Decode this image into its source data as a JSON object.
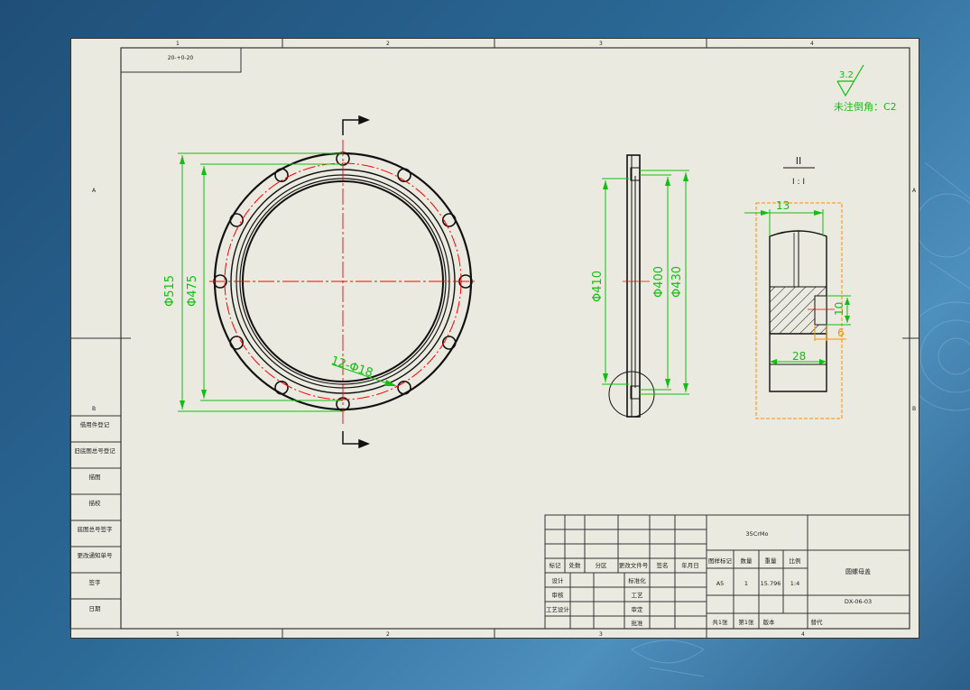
{
  "drawing": {
    "code_box": "20-+0-20",
    "zone_numbers_top": [
      "1",
      "2",
      "3",
      "4"
    ],
    "zone_numbers_bottom": [
      "1",
      "2",
      "3",
      "4"
    ],
    "zone_letters_left": [
      "A",
      "B"
    ],
    "zone_letters_right": [
      "A",
      "B"
    ],
    "surface_roughness": "3.2",
    "unmarked_chamfer_note": "未注倒角：C2",
    "detail_marker_top": "II",
    "detail_marker_bottom": "I : I",
    "dimensions": {
      "outer_diameter": "Φ515",
      "inner_circle": "Φ475",
      "slots": "12-Φ18",
      "side_410": "Φ410",
      "side_400": "Φ400",
      "side_430": "Φ430",
      "detail_13": "13",
      "detail_10": "10",
      "detail_6": "6",
      "detail_28": "28"
    }
  },
  "left_table": {
    "rows": [
      "借用件登记",
      "旧底图总号登记",
      "描图",
      "描校",
      "底图总号签字",
      "更改通知单号",
      "签字",
      "日期"
    ]
  },
  "title_block": {
    "material": "35CrMo",
    "part_name": "圆螺母盖",
    "drawing_no": "DX-06-03",
    "header_labels": [
      "图样标记",
      "数量",
      "重量",
      "比例"
    ],
    "header_values": [
      "A5",
      "1",
      "15.796",
      "1:4"
    ],
    "revision_labels": [
      "标记",
      "处数",
      "分区",
      "更改文件号",
      "签名",
      "年月日"
    ],
    "sign_labels_left": [
      "设计",
      "审核",
      "工艺设计"
    ],
    "sign_labels_right": [
      "标准化",
      "工艺",
      "审定",
      "批准"
    ],
    "sheet_info": [
      "共1张",
      "第1张",
      "版本",
      "替代"
    ]
  },
  "colors": {
    "dimension": "#10c010",
    "centerline": "#ff0000",
    "detail": "#ff8c00",
    "background": "#2c6a97",
    "paper": "#ebeae0"
  }
}
